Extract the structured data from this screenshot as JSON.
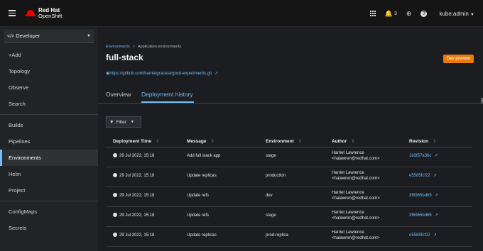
{
  "masthead": {
    "brand_line1": "Red Hat",
    "brand_line2": "OpenShift",
    "notification_count": "3",
    "user": "kube:admin"
  },
  "sidebar": {
    "perspective": "Developer",
    "items": [
      {
        "label": "+Add",
        "active": false
      },
      {
        "label": "Topology",
        "active": false
      },
      {
        "label": "Observe",
        "active": false
      },
      {
        "label": "Search",
        "active": false
      },
      {
        "label": "Builds",
        "active": false
      },
      {
        "label": "Pipelines",
        "active": false
      },
      {
        "label": "Environments",
        "active": true
      },
      {
        "label": "Helm",
        "active": false
      },
      {
        "label": "Project",
        "active": false
      },
      {
        "label": "ConfigMaps",
        "active": false
      },
      {
        "label": "Secrets",
        "active": false
      }
    ]
  },
  "breadcrumb": {
    "link": "Environments",
    "current": "Application environments"
  },
  "page": {
    "title": "full-stack",
    "badge": "Dev preview",
    "repo_url": "https://github.com/harrietgrace/argocd-experiments.git"
  },
  "tabs": [
    {
      "label": "Overview",
      "active": false
    },
    {
      "label": "Deployment history",
      "active": true
    }
  ],
  "filter": {
    "label": "Filter"
  },
  "table": {
    "columns": [
      "Deployment Time",
      "Message",
      "Environment",
      "Author",
      "Revision"
    ],
    "rows": [
      {
        "time": "29 Jul 2022, 15:18",
        "message": "Add full stack app",
        "environment": "stage",
        "author_name": "Harriet Lawrence",
        "author_email": "<halawren@redhat.com>",
        "revision": "1b3f57a36c"
      },
      {
        "time": "29 Jul 2022, 15:18",
        "message": "Update replicas",
        "environment": "production",
        "author_name": "Harriet Lawrence",
        "author_email": "<halawren@redhat.com>",
        "revision": "e5585fcf22"
      },
      {
        "time": "29 Jul 2022, 15:18",
        "message": "Update refs",
        "environment": "dev",
        "author_name": "Harriet Lawrence",
        "author_email": "<halawren@redhat.com>",
        "revision": "3f6965bd65"
      },
      {
        "time": "29 Jul 2022, 15:18",
        "message": "Update refs",
        "environment": "stage",
        "author_name": "Harriet Lawrence",
        "author_email": "<halawren@redhat.com>",
        "revision": "3f6965bd65"
      },
      {
        "time": "29 Jul 2022, 15:18",
        "message": "Update replicas",
        "environment": "prod-replica",
        "author_name": "Harriet Lawrence",
        "author_email": "<halawren@redhat.com>",
        "revision": "e5585fcf22"
      }
    ]
  },
  "colors": {
    "accent": "#73bcf7",
    "brand_red": "#ee0000",
    "badge_orange": "#ec7a08"
  }
}
